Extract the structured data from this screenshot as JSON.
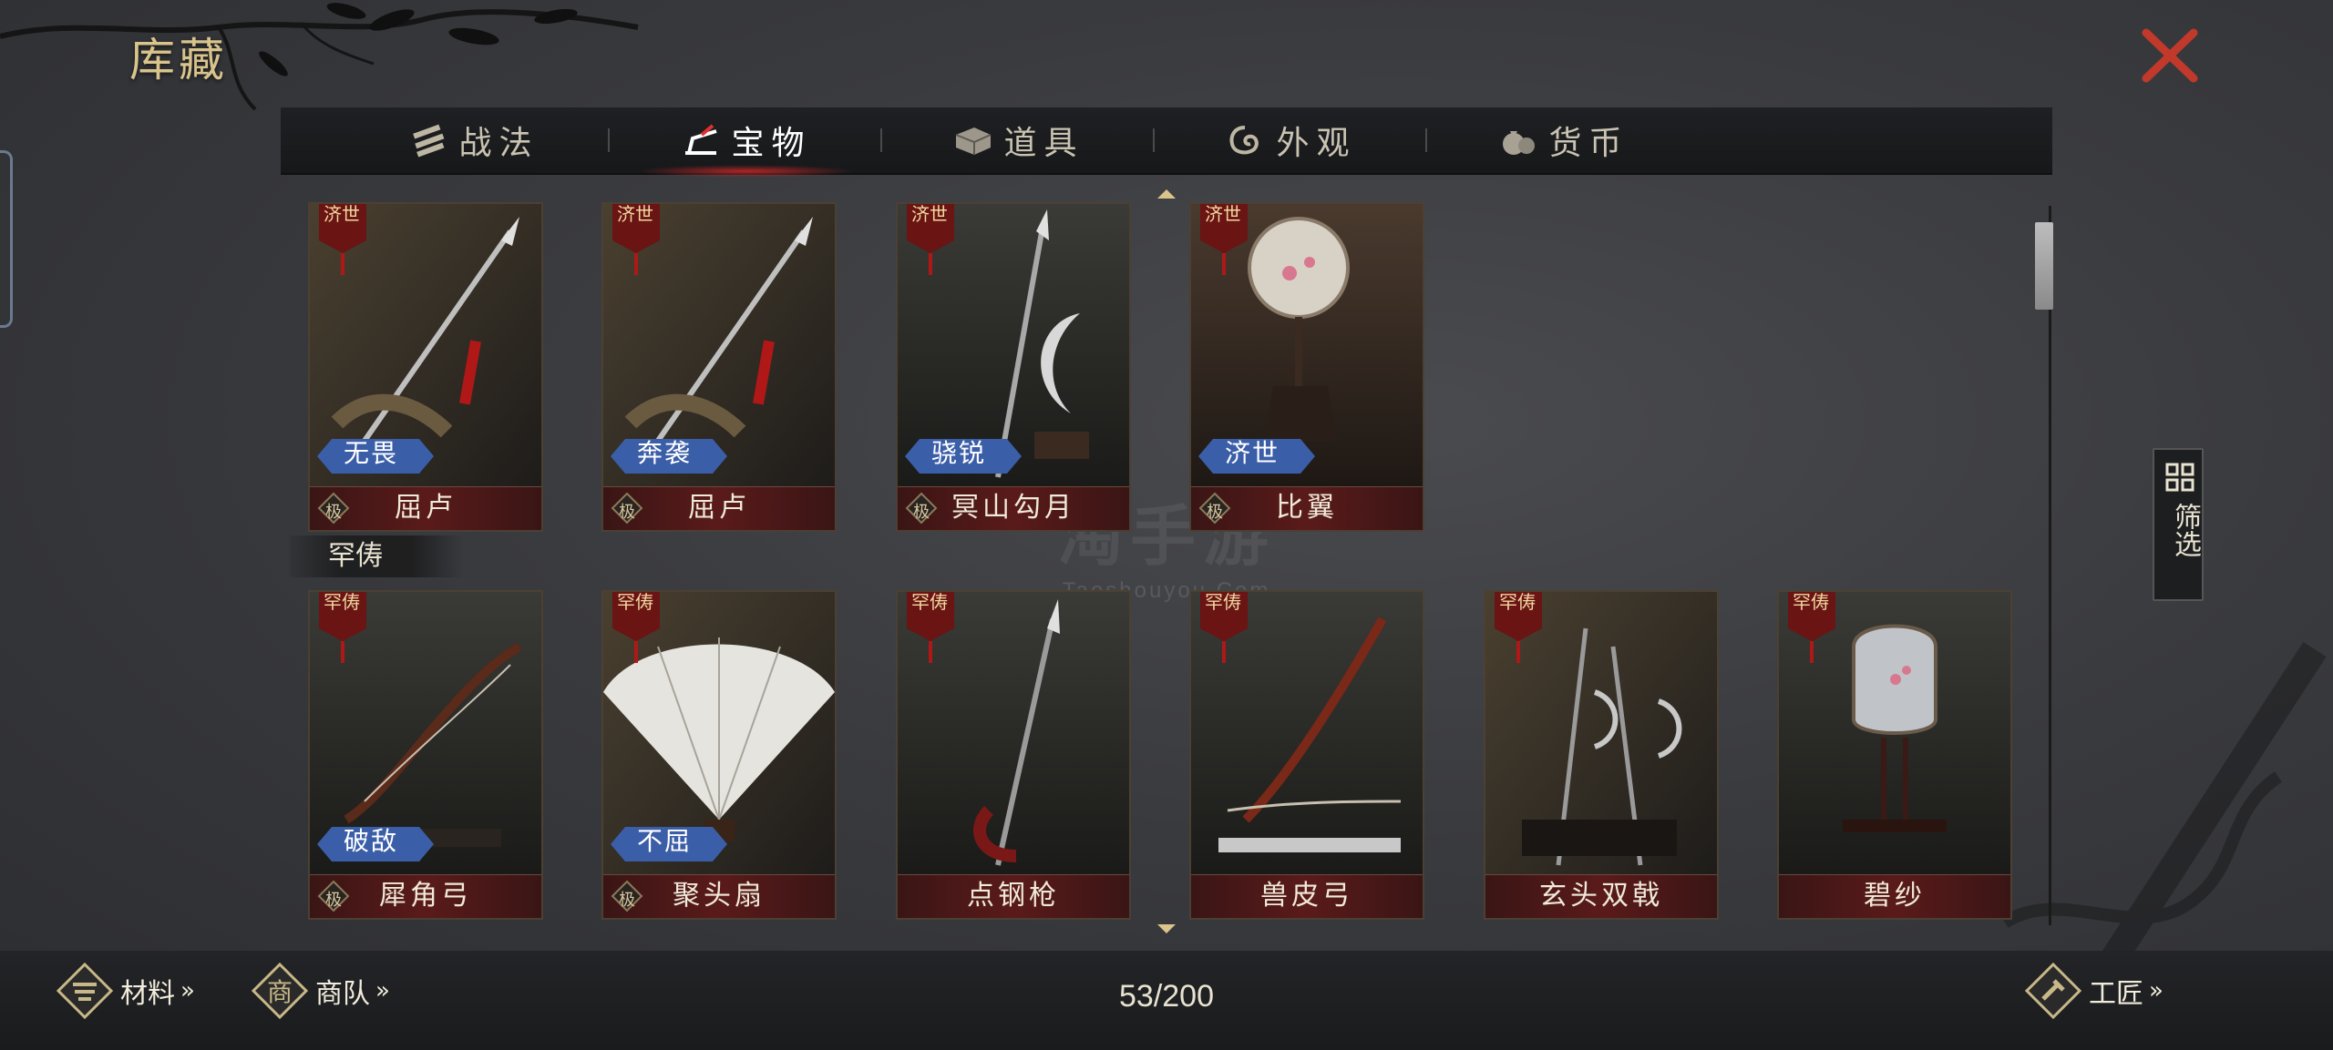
{
  "header": {
    "title": "库藏",
    "close_icon": "close-icon"
  },
  "tabs": [
    {
      "label": "战法",
      "icon": "scroll-bundle-icon",
      "active": false
    },
    {
      "label": "宝物",
      "icon": "treasure-icon",
      "active": true
    },
    {
      "label": "道具",
      "icon": "chest-icon",
      "active": false
    },
    {
      "label": "外观",
      "icon": "swirl-icon",
      "active": false
    },
    {
      "label": "货币",
      "icon": "money-bag-icon",
      "active": false
    }
  ],
  "section_rare": {
    "label": "罕俦"
  },
  "cards": [
    {
      "name": "屈卢",
      "grade": "极",
      "badge": "无畏",
      "tag": "济世",
      "art": "spear"
    },
    {
      "name": "屈卢",
      "grade": "极",
      "badge": "奔袭",
      "tag": "济世",
      "art": "spear"
    },
    {
      "name": "冥山勾月",
      "grade": "极",
      "badge": "骁锐",
      "tag": "济世",
      "art": "crescent"
    },
    {
      "name": "比翼",
      "grade": "极",
      "badge": "济世",
      "tag": "济世",
      "art": "fan"
    },
    {
      "name": "犀角弓",
      "grade": "极",
      "badge": "破敌",
      "tag": "罕俦",
      "art": "bow"
    },
    {
      "name": "聚头扇",
      "grade": "极",
      "badge": "不屈",
      "tag": "罕俦",
      "art": "featherfan"
    },
    {
      "name": "点钢枪",
      "grade": "",
      "badge": "",
      "tag": "罕俦",
      "art": "lance"
    },
    {
      "name": "兽皮弓",
      "grade": "",
      "badge": "",
      "tag": "罕俦",
      "art": "bow2"
    },
    {
      "name": "玄头双戟",
      "grade": "",
      "badge": "",
      "tag": "罕俦",
      "art": "halberds"
    },
    {
      "name": "碧纱",
      "grade": "",
      "badge": "",
      "tag": "罕俦",
      "art": "screen"
    }
  ],
  "filter": {
    "label": "筛选",
    "icon": "grid-icon"
  },
  "bottom": {
    "materials": {
      "label": "材料",
      "arrow": "»",
      "icon": "materials-icon"
    },
    "caravan": {
      "label": "商队",
      "arrow": "»",
      "icon": "caravan-icon"
    },
    "craftsman": {
      "label": "工匠",
      "arrow": "»",
      "icon": "craftsman-icon"
    },
    "count": "53/200"
  },
  "watermark": {
    "main": "淘手游",
    "sub": "Taoshouyou.Com"
  },
  "colors": {
    "accent_gold": "#d9c48c",
    "close_red": "#c0392b",
    "badge_blue": "#3b5ea8",
    "namebar_red": "#5a1a1a"
  }
}
